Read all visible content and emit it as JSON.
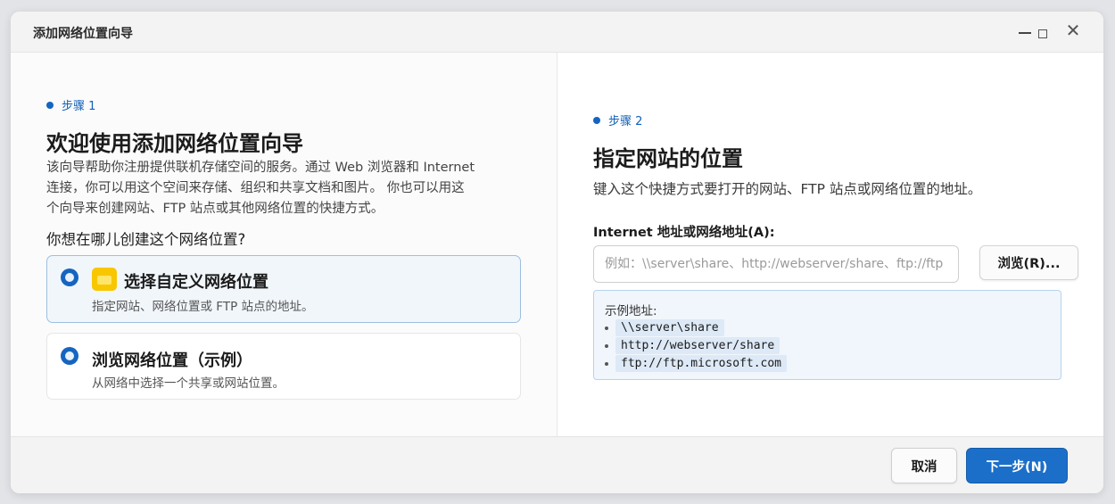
{
  "colors": {
    "accent": "#1565c0",
    "primary_button": "#1c6fc9",
    "folder": "#f8c700",
    "example_bg": "#f1f6fc"
  },
  "window": {
    "title": "添加网络位置向导",
    "controls": {
      "minimize_icon": "minimize-icon",
      "maximize_icon": "maximize-icon",
      "close_glyph": "✕"
    }
  },
  "left": {
    "step": "步骤 1",
    "heading": "欢迎使用添加网络位置向导",
    "intro_lines": [
      "该向导帮助你注册提供联机存储空间的服务。通过 Web 浏览器和 Internet",
      "连接，你可以用这个空间来存储、组织和共享文档和图片。 你也可以用这",
      "个向导来创建网站、FTP 站点或其他网络位置的快捷方式。"
    ],
    "question": "你想在哪儿创建这个网络位置?",
    "options": [
      {
        "title": "选择自定义网络位置",
        "description": "指定网站、网络位置或 FTP 站点的地址。",
        "icon": "folder-icon",
        "selected": true
      },
      {
        "title": "浏览网络位置（示例）",
        "description": "从网络中选择一个共享或网站位置。",
        "selected": false
      }
    ]
  },
  "right": {
    "step": "步骤 2",
    "heading": "指定网站的位置",
    "description": "键入这个快捷方式要打开的网站、FTP 站点或网络位置的地址。",
    "field_label": "Internet 地址或网络地址(A):",
    "input_value": "",
    "input_placeholder": "例如：\\\\server\\share、http://webserver/share、ftp://ftp",
    "browse_label": "浏览(R)...",
    "examples_title": "示例地址:",
    "examples": [
      "\\\\server\\share",
      "http://webserver/share",
      "ftp://ftp.microsoft.com"
    ]
  },
  "footer": {
    "cancel_label": "取消",
    "next_label": "下一步(N)"
  }
}
